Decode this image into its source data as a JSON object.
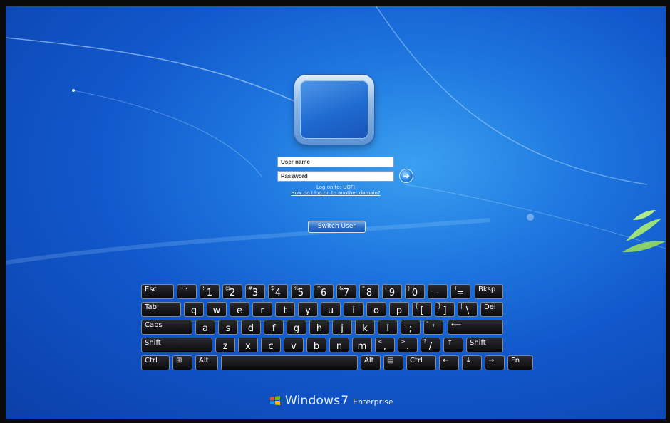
{
  "login": {
    "username_placeholder": "User name",
    "password_placeholder": "Password",
    "logon_to": "Log on to: UOFI",
    "domain_link": "How do I log on to another domain?",
    "switch_user": "Switch User"
  },
  "keyboard": {
    "rows": [
      [
        {
          "id": "esc",
          "main": "Esc",
          "type": "label"
        },
        {
          "id": "tilde",
          "main": "`",
          "shift": "~",
          "type": "char"
        },
        {
          "id": "1",
          "main": "1",
          "shift": "!",
          "type": "char"
        },
        {
          "id": "2",
          "main": "2",
          "shift": "@",
          "type": "char"
        },
        {
          "id": "3",
          "main": "3",
          "shift": "#",
          "type": "char"
        },
        {
          "id": "4",
          "main": "4",
          "shift": "$",
          "type": "char"
        },
        {
          "id": "5",
          "main": "5",
          "shift": "%",
          "type": "char"
        },
        {
          "id": "6",
          "main": "6",
          "shift": "^",
          "type": "char"
        },
        {
          "id": "7",
          "main": "7",
          "shift": "&",
          "type": "char"
        },
        {
          "id": "8",
          "main": "8",
          "shift": "*",
          "type": "char"
        },
        {
          "id": "9",
          "main": "9",
          "shift": "(",
          "type": "char"
        },
        {
          "id": "0",
          "main": "0",
          "shift": ")",
          "type": "char"
        },
        {
          "id": "minus",
          "main": "-",
          "shift": "_",
          "type": "char"
        },
        {
          "id": "equals",
          "main": "=",
          "shift": "+",
          "type": "char"
        },
        {
          "id": "bksp",
          "main": "Bksp",
          "type": "label"
        }
      ],
      [
        {
          "id": "tab",
          "main": "Tab",
          "type": "label"
        },
        {
          "id": "q",
          "main": "q",
          "type": "char"
        },
        {
          "id": "w",
          "main": "w",
          "type": "char"
        },
        {
          "id": "e",
          "main": "e",
          "type": "char"
        },
        {
          "id": "r",
          "main": "r",
          "type": "char"
        },
        {
          "id": "t",
          "main": "t",
          "type": "char"
        },
        {
          "id": "y",
          "main": "y",
          "type": "char"
        },
        {
          "id": "u",
          "main": "u",
          "type": "char"
        },
        {
          "id": "i",
          "main": "i",
          "type": "char"
        },
        {
          "id": "o",
          "main": "o",
          "type": "char"
        },
        {
          "id": "p",
          "main": "p",
          "type": "char"
        },
        {
          "id": "lbracket",
          "main": "[",
          "shift": "{",
          "type": "char"
        },
        {
          "id": "rbracket",
          "main": "]",
          "shift": "}",
          "type": "char"
        },
        {
          "id": "backslash",
          "main": "\\",
          "shift": "|",
          "type": "char"
        },
        {
          "id": "del",
          "main": "Del",
          "type": "label"
        }
      ],
      [
        {
          "id": "caps",
          "main": "Caps",
          "type": "label"
        },
        {
          "id": "a",
          "main": "a",
          "type": "char"
        },
        {
          "id": "s",
          "main": "s",
          "type": "char"
        },
        {
          "id": "d",
          "main": "d",
          "type": "char"
        },
        {
          "id": "f",
          "main": "f",
          "type": "char"
        },
        {
          "id": "g",
          "main": "g",
          "type": "char"
        },
        {
          "id": "h",
          "main": "h",
          "type": "char"
        },
        {
          "id": "j",
          "main": "j",
          "type": "char"
        },
        {
          "id": "k",
          "main": "k",
          "type": "char"
        },
        {
          "id": "l",
          "main": "l",
          "type": "char"
        },
        {
          "id": "semicolon",
          "main": ";",
          "shift": ":",
          "type": "char"
        },
        {
          "id": "quote",
          "main": "'",
          "shift": "\"",
          "type": "char"
        },
        {
          "id": "enter",
          "main": "⟵",
          "type": "label"
        }
      ],
      [
        {
          "id": "lshift",
          "main": "Shift",
          "type": "label"
        },
        {
          "id": "z",
          "main": "z",
          "type": "char"
        },
        {
          "id": "x",
          "main": "x",
          "type": "char"
        },
        {
          "id": "c",
          "main": "c",
          "type": "char"
        },
        {
          "id": "v",
          "main": "v",
          "type": "char"
        },
        {
          "id": "b",
          "main": "b",
          "type": "char"
        },
        {
          "id": "n",
          "main": "n",
          "type": "char"
        },
        {
          "id": "m",
          "main": "m",
          "type": "char"
        },
        {
          "id": "comma",
          "main": ",",
          "shift": "<",
          "type": "char"
        },
        {
          "id": "period",
          "main": ".",
          "shift": ">",
          "type": "char"
        },
        {
          "id": "slash",
          "main": "/",
          "shift": "?",
          "type": "char"
        },
        {
          "id": "up",
          "main": "↑",
          "type": "label"
        },
        {
          "id": "rshift",
          "main": "Shift",
          "type": "label"
        }
      ],
      [
        {
          "id": "lctrl",
          "main": "Ctrl",
          "type": "label"
        },
        {
          "id": "win",
          "main": "⊞",
          "type": "label"
        },
        {
          "id": "lalt",
          "main": "Alt",
          "type": "label"
        },
        {
          "id": "space",
          "main": "",
          "type": "label"
        },
        {
          "id": "ralt",
          "main": "Alt",
          "type": "label"
        },
        {
          "id": "menu",
          "main": "▤",
          "type": "label"
        },
        {
          "id": "rctrl",
          "main": "Ctrl",
          "type": "label"
        },
        {
          "id": "left",
          "main": "←",
          "type": "label"
        },
        {
          "id": "down",
          "main": "↓",
          "type": "label"
        },
        {
          "id": "right",
          "main": "→",
          "type": "label"
        },
        {
          "id": "fn",
          "main": "Fn",
          "type": "label"
        }
      ]
    ]
  },
  "branding": {
    "word": "Windows",
    "version": "7",
    "edition": "Enterprise",
    "icon": "windows-flag-icon"
  },
  "icons": {
    "go": "arrow-right-icon"
  },
  "colors": {
    "background_blue": "#1158cc",
    "key_fill": "#0a0a0c",
    "key_border": "#7e8a9a",
    "text_light": "#e8f1ff"
  }
}
